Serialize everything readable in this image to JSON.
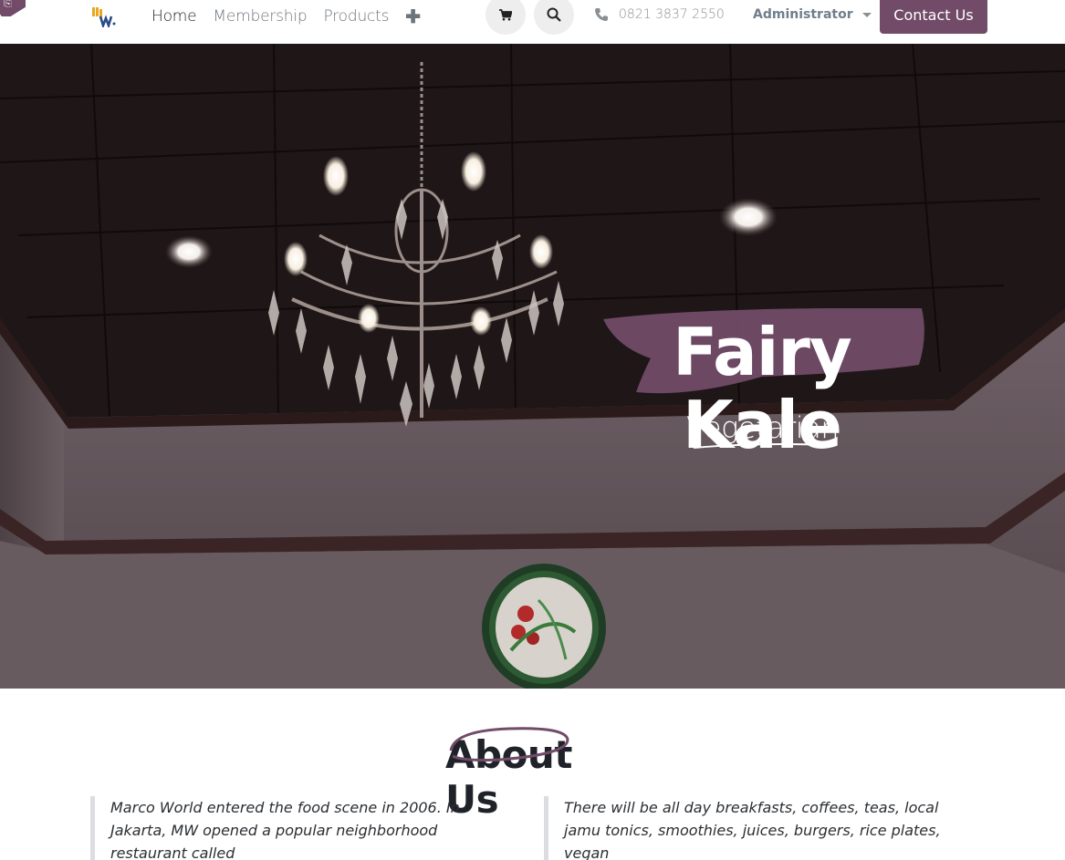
{
  "header": {
    "logo_alt": "MW",
    "nav": [
      {
        "label": "Home"
      },
      {
        "label": "Membership"
      },
      {
        "label": "Products"
      }
    ],
    "phone": "0821 3837 2550",
    "user_menu": "Administrator",
    "contact_button": "Contact Us",
    "accent_color": "#714b67"
  },
  "hero": {
    "title": "Fairy Kale",
    "subtitle": "Vegetarian"
  },
  "about": {
    "title": "About Us",
    "left_text": "Marco World entered the food scene in 2006. In Jakarta, MW opened a popular neighborhood restaurant called",
    "right_text": "There will be all day breakfasts, coffees, teas, local jamu tonics, smoothies, juices, burgers, rice plates, vegan"
  },
  "icons": {
    "cart": "cart-icon",
    "search": "search-icon",
    "phone": "phone-icon",
    "add": "plus-icon"
  }
}
